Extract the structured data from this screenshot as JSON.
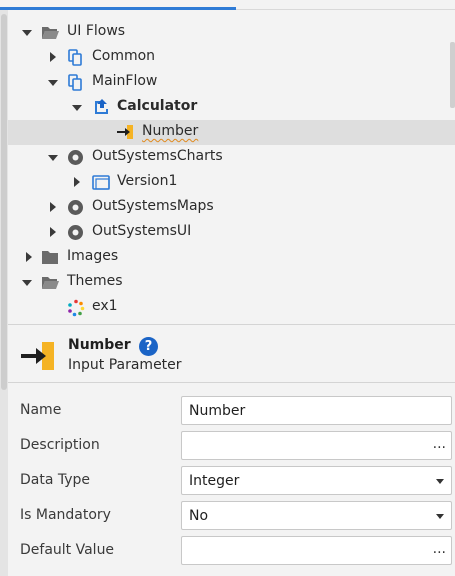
{
  "tree": {
    "items": [
      {
        "label": "UI Flows",
        "icon": "folder-open-icon",
        "expander": "expanded"
      },
      {
        "label": "Common",
        "icon": "flow-icon",
        "expander": "collapsed"
      },
      {
        "label": "MainFlow",
        "icon": "flow-icon",
        "expander": "expanded"
      },
      {
        "label": "Calculator",
        "icon": "screen-icon",
        "expander": "expanded"
      },
      {
        "label": "Number",
        "icon": "input-parameter-icon",
        "expander": "none"
      },
      {
        "label": "OutSystemsCharts",
        "icon": "module-reference-icon",
        "expander": "expanded"
      },
      {
        "label": "Version1",
        "icon": "window-icon",
        "expander": "collapsed"
      },
      {
        "label": "OutSystemsMaps",
        "icon": "module-reference-icon",
        "expander": "collapsed"
      },
      {
        "label": "OutSystemsUI",
        "icon": "module-reference-icon",
        "expander": "collapsed"
      },
      {
        "label": "Images",
        "icon": "folder-icon",
        "expander": "collapsed"
      },
      {
        "label": "Themes",
        "icon": "folder-open-icon",
        "expander": "expanded"
      },
      {
        "label": "ex1",
        "icon": "theme-icon",
        "expander": "none"
      }
    ]
  },
  "header": {
    "title": "Number",
    "help": "?",
    "subtitle": "Input Parameter"
  },
  "properties": [
    {
      "label": "Name",
      "value": "Number",
      "kind": "text"
    },
    {
      "label": "Description",
      "value": "",
      "kind": "ellipsis",
      "button": "..."
    },
    {
      "label": "Data Type",
      "value": "Integer",
      "kind": "dropdown"
    },
    {
      "label": "Is Mandatory",
      "value": "No",
      "kind": "dropdown"
    },
    {
      "label": "Default Value",
      "value": "",
      "kind": "ellipsis",
      "button": "..."
    }
  ],
  "colors": {
    "accent": "#2e7bd6",
    "help_badge": "#1b64c6",
    "parameter_icon": "#f5b324",
    "selection": "#dedede"
  }
}
